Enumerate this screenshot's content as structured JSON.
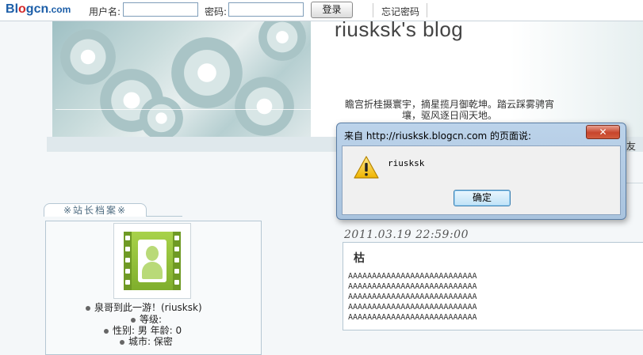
{
  "topbar": {
    "logo": {
      "b": "B",
      "l": "l",
      "o": "o",
      "rest": "gcn",
      "dom": ".com"
    },
    "username_label": "用户名:",
    "username_value": "",
    "password_label": "密码:",
    "password_value": "",
    "login_label": "登录",
    "forgot_label": "忘记密码"
  },
  "header": {
    "blog_title": "riusksk's blog",
    "motto": "瞻宫折桂摄寰宇，摘星揽月御乾坤。踏云踩雾骋宵壤，驱风逐日闯天地。",
    "side_fragment": "友"
  },
  "sidebar": {
    "tab_label": "※站长档案※",
    "profile": {
      "name_line": "泉哥到此一游！(riusksk)",
      "level_line": "等级:",
      "gender_line": "性别: 男 年龄: 0",
      "city_line": "城市: 保密"
    }
  },
  "post": {
    "date": "2011.03.19 22:59:00",
    "title": "枯",
    "lines": [
      "AAAAAAAAAAAAAAAAAAAAAAAAAAA",
      "AAAAAAAAAAAAAAAAAAAAAAAAAAA",
      "AAAAAAAAAAAAAAAAAAAAAAAAAAA",
      "AAAAAAAAAAAAAAAAAAAAAAAAAAA",
      "AAAAAAAAAAAAAAAAAAAAAAAAAAA"
    ]
  },
  "dialog": {
    "title": "来自 http://riusksk.blogcn.com 的页面说:",
    "close_glyph": "✕",
    "icon": "warning-icon",
    "message": "riusksk",
    "ok_label": "确定"
  },
  "colors": {
    "accent": "#1c5ea8",
    "logo_red": "#d42a2a",
    "close_red": "#c7452c"
  }
}
